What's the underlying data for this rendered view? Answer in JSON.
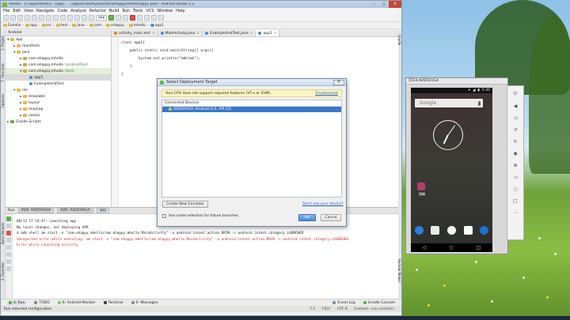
{
  "ide": {
    "title": "mhello - [F:\\app\\mhello] - [app] - ...\\app\\src\\test\\java\\com\\ehappy\\mhello\\app1.java - Android Studio 2.3",
    "menu": [
      "File",
      "Edit",
      "View",
      "Navigate",
      "Code",
      "Analyze",
      "Refactor",
      "Build",
      "Run",
      "Tools",
      "VCS",
      "Window",
      "Help"
    ],
    "toolbar": {
      "config_label": "app"
    },
    "breadcrumb": [
      "Exhello",
      "app",
      "src",
      "test",
      "java",
      "com",
      "ehappy",
      "mhello",
      "app1"
    ],
    "project_panel": {
      "header": "Android",
      "items": [
        {
          "label": "app",
          "indent": 0
        },
        {
          "label": "manifests",
          "indent": 1
        },
        {
          "label": "java",
          "indent": 1
        },
        {
          "label": "com.ehappy.mhello",
          "indent": 2,
          "note": ""
        },
        {
          "label": "com.ehappy.mhello",
          "indent": 2,
          "note": "(androidTest)"
        },
        {
          "label": "com.ehappy.mhello",
          "indent": 2,
          "note": "(test)"
        },
        {
          "label": "app1",
          "indent": 3,
          "note": ""
        },
        {
          "label": "ExampleUnitTest",
          "indent": 3,
          "note": ""
        },
        {
          "label": "res",
          "indent": 1
        },
        {
          "label": "drawable",
          "indent": 2
        },
        {
          "label": "layout",
          "indent": 2
        },
        {
          "label": "mipmap",
          "indent": 2
        },
        {
          "label": "values",
          "indent": 2
        },
        {
          "label": "Gradle Scripts",
          "indent": 0
        }
      ]
    },
    "editor": {
      "tabs": [
        "activity_main.xml",
        "MainActivity.java",
        "ExampleUnitTest.java",
        "app1"
      ],
      "code": [
        "class app1{",
        "",
        "    public static void main(String[] args){",
        "",
        "",
        "        System.out.println(\"mdelak\");",
        "",
        "    }",
        "}"
      ]
    },
    "run_panel": {
      "header_label": "Run",
      "tabs": [
        "AVD: AVD5HVGA",
        "AVD: AVD5HVGA",
        "app"
      ],
      "console": [
        "08/13 17:14:47: Launching app",
        "No local changes, not deploying APK",
        "$ adb shell am start -n \"com.ehappy.mhello/com.ehappy.mhello.MainActivity\" -a android.intent.action.MAIN -c android.intent.category.LAUNCHER",
        "Unexpected error while executing: am start -n \"com.ehappy.mhello/com.ehappy.mhello.MainActivity\" -a android.intent.action.MAIN -c android.intent.category.LAUNCHER",
        "Error while Launching activity"
      ]
    },
    "bottom_tabs": [
      "4: Run",
      "TODO",
      "6: Android Monitor",
      "Terminal",
      "0: Messages"
    ],
    "bottom_right_tabs": [
      "Event Log",
      "Gradle Console"
    ],
    "status": {
      "message": "Run selected configuration",
      "position": "7:1",
      "line_sep": "CRLF",
      "encoding": "UTF-8",
      "context": "Context: <no context>"
    }
  },
  "dialog": {
    "title": "Select Deployment Target",
    "warning": "Your CPU does not support required features (VT-x or SVM).",
    "troubleshoot_link": "Troubleshoot",
    "connected_header": "Connected Devices",
    "device": "AVD5HVGA (Android 6.0, API 23)",
    "create_button": "Create New Emulator",
    "dont_see_link": "Don't see your device?",
    "checkbox_label": "Use same selection for future launches",
    "ok_button": "OK",
    "cancel_button": "Cancel"
  },
  "emulator": {
    "title": "5554:AVD5HVGA",
    "time": "5:35",
    "search_hint": "Google",
    "app_label": "相機"
  }
}
